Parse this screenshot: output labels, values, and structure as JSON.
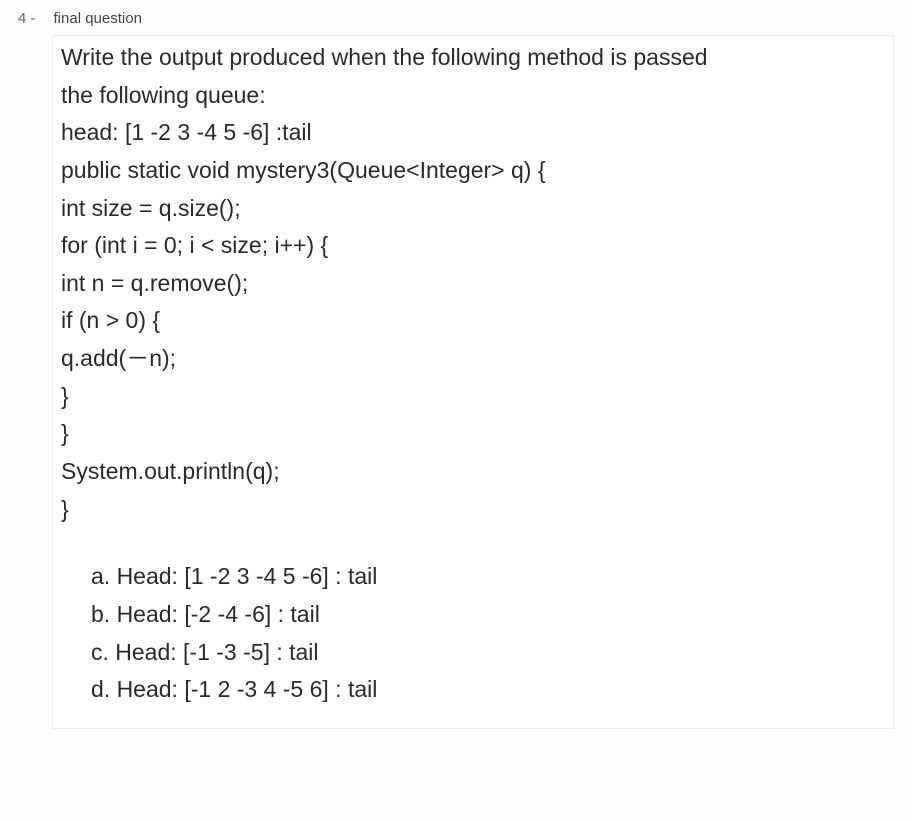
{
  "header": {
    "number": "4 -",
    "title": "final question"
  },
  "prompt": {
    "line1": "Write the output produced when the following method is passed",
    "line2": "the following queue:",
    "line3": "head: [1  -2  3  -4  5  -6] :tail"
  },
  "code": {
    "l1": "public static void mystery3(Queue<Integer> q) {",
    "l2": "int size = q.size();",
    "l3": "for (int i = 0; i < size; i++) {",
    "l4": "int n = q.remove();",
    "l5": "if (n > 0) {",
    "l6": "q.add(－n);",
    "l7": "}",
    "l8": "}",
    "l9": "System.out.println(q);",
    "l10": "}"
  },
  "options": {
    "a": "a.  Head: [1 -2  3  -4  5  -6] : tail",
    "b": "b.  Head: [-2  -4  -6] : tail",
    "c": "c.  Head: [-1  -3  -5] : tail",
    "d": "d.  Head: [-1  2  -3  4  -5  6] : tail"
  }
}
